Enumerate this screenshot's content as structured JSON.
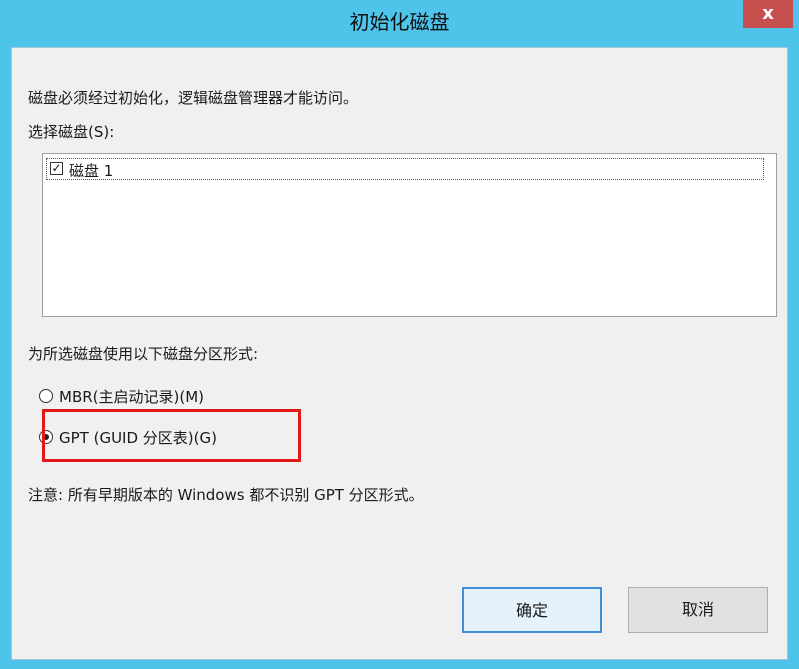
{
  "window": {
    "title": "初始化磁盘",
    "close_label": "x"
  },
  "dialog": {
    "description": "磁盘必须经过初始化，逻辑磁盘管理器才能访问。",
    "select_disk_label": "选择磁盘(S):",
    "disks": [
      {
        "label": "磁盘 1",
        "checked": true
      }
    ],
    "partition_style_label": "为所选磁盘使用以下磁盘分区形式:",
    "options": [
      {
        "label": "MBR(主启动记录)(M)",
        "selected": false
      },
      {
        "label": "GPT (GUID 分区表)(G)",
        "selected": true
      }
    ],
    "note": "注意: 所有早期版本的 Windows 都不识别 GPT 分区形式。",
    "ok_label": "确定",
    "cancel_label": "取消"
  },
  "colors": {
    "titlebar": "#4fc4ea",
    "close_button": "#c7504f",
    "highlight": "#e01818"
  }
}
